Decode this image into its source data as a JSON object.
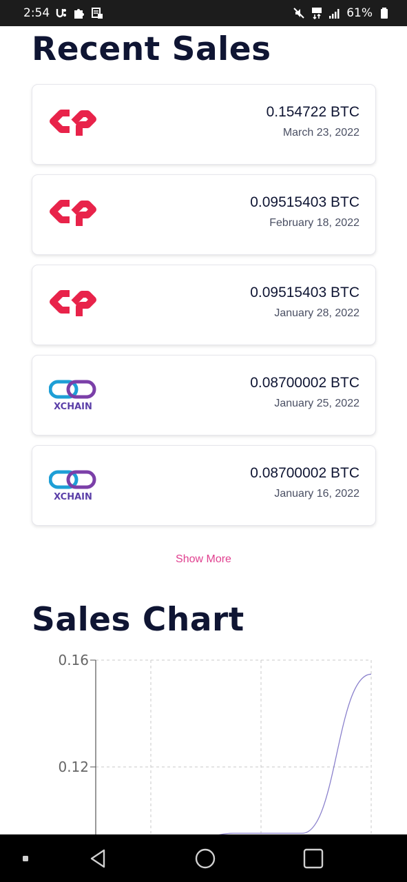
{
  "status_bar": {
    "time": "2:54",
    "battery": "61%"
  },
  "recent_sales": {
    "title": "Recent Sales",
    "items": [
      {
        "amount": "0.154722 BTC",
        "date": "March 23, 2022",
        "logo": "counterparty-logo"
      },
      {
        "amount": "0.09515403 BTC",
        "date": "February 18, 2022",
        "logo": "counterparty-logo"
      },
      {
        "amount": "0.09515403 BTC",
        "date": "January 28, 2022",
        "logo": "counterparty-logo"
      },
      {
        "amount": "0.08700002 BTC",
        "date": "January 25, 2022",
        "logo": "xchain-logo",
        "logo_text": "XCHAIN"
      },
      {
        "amount": "0.08700002 BTC",
        "date": "January 16, 2022",
        "logo": "xchain-logo",
        "logo_text": "XCHAIN"
      }
    ],
    "show_more_label": "Show More"
  },
  "sales_chart": {
    "title": "Sales Chart"
  },
  "chart_data": {
    "type": "line",
    "ylim": [
      0.08,
      0.16
    ],
    "y_ticks": [
      "0.16",
      "0.12"
    ],
    "x": [
      0,
      1,
      2,
      3,
      4
    ],
    "values": [
      0.08700002,
      0.08700002,
      0.09515403,
      0.09515403,
      0.154722
    ],
    "grid": true,
    "line_color": "#8a80cc"
  },
  "colors": {
    "accent": "#e0408f",
    "counterparty_red": "#e8234a",
    "xchain_blue": "#1e9fd6",
    "xchain_purple": "#7b3fa8",
    "title_color": "#0f1533"
  },
  "nav_bar": {
    "icons": [
      "recent-apps-dot-icon",
      "back-icon",
      "home-icon",
      "overview-icon"
    ]
  }
}
